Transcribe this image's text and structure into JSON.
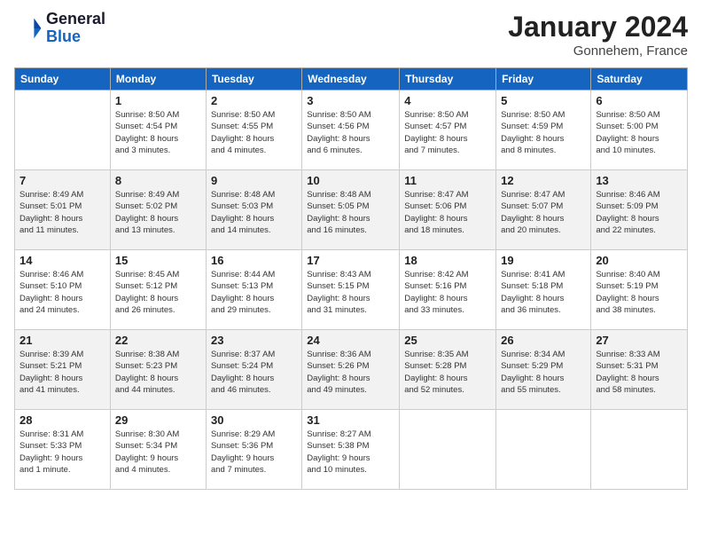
{
  "header": {
    "logo_line1": "General",
    "logo_line2": "Blue",
    "month_title": "January 2024",
    "location": "Gonnehem, France"
  },
  "weekdays": [
    "Sunday",
    "Monday",
    "Tuesday",
    "Wednesday",
    "Thursday",
    "Friday",
    "Saturday"
  ],
  "weeks": [
    [
      {
        "day": "",
        "info": ""
      },
      {
        "day": "1",
        "info": "Sunrise: 8:50 AM\nSunset: 4:54 PM\nDaylight: 8 hours\nand 3 minutes."
      },
      {
        "day": "2",
        "info": "Sunrise: 8:50 AM\nSunset: 4:55 PM\nDaylight: 8 hours\nand 4 minutes."
      },
      {
        "day": "3",
        "info": "Sunrise: 8:50 AM\nSunset: 4:56 PM\nDaylight: 8 hours\nand 6 minutes."
      },
      {
        "day": "4",
        "info": "Sunrise: 8:50 AM\nSunset: 4:57 PM\nDaylight: 8 hours\nand 7 minutes."
      },
      {
        "day": "5",
        "info": "Sunrise: 8:50 AM\nSunset: 4:59 PM\nDaylight: 8 hours\nand 8 minutes."
      },
      {
        "day": "6",
        "info": "Sunrise: 8:50 AM\nSunset: 5:00 PM\nDaylight: 8 hours\nand 10 minutes."
      }
    ],
    [
      {
        "day": "7",
        "info": "Sunrise: 8:49 AM\nSunset: 5:01 PM\nDaylight: 8 hours\nand 11 minutes."
      },
      {
        "day": "8",
        "info": "Sunrise: 8:49 AM\nSunset: 5:02 PM\nDaylight: 8 hours\nand 13 minutes."
      },
      {
        "day": "9",
        "info": "Sunrise: 8:48 AM\nSunset: 5:03 PM\nDaylight: 8 hours\nand 14 minutes."
      },
      {
        "day": "10",
        "info": "Sunrise: 8:48 AM\nSunset: 5:05 PM\nDaylight: 8 hours\nand 16 minutes."
      },
      {
        "day": "11",
        "info": "Sunrise: 8:47 AM\nSunset: 5:06 PM\nDaylight: 8 hours\nand 18 minutes."
      },
      {
        "day": "12",
        "info": "Sunrise: 8:47 AM\nSunset: 5:07 PM\nDaylight: 8 hours\nand 20 minutes."
      },
      {
        "day": "13",
        "info": "Sunrise: 8:46 AM\nSunset: 5:09 PM\nDaylight: 8 hours\nand 22 minutes."
      }
    ],
    [
      {
        "day": "14",
        "info": "Sunrise: 8:46 AM\nSunset: 5:10 PM\nDaylight: 8 hours\nand 24 minutes."
      },
      {
        "day": "15",
        "info": "Sunrise: 8:45 AM\nSunset: 5:12 PM\nDaylight: 8 hours\nand 26 minutes."
      },
      {
        "day": "16",
        "info": "Sunrise: 8:44 AM\nSunset: 5:13 PM\nDaylight: 8 hours\nand 29 minutes."
      },
      {
        "day": "17",
        "info": "Sunrise: 8:43 AM\nSunset: 5:15 PM\nDaylight: 8 hours\nand 31 minutes."
      },
      {
        "day": "18",
        "info": "Sunrise: 8:42 AM\nSunset: 5:16 PM\nDaylight: 8 hours\nand 33 minutes."
      },
      {
        "day": "19",
        "info": "Sunrise: 8:41 AM\nSunset: 5:18 PM\nDaylight: 8 hours\nand 36 minutes."
      },
      {
        "day": "20",
        "info": "Sunrise: 8:40 AM\nSunset: 5:19 PM\nDaylight: 8 hours\nand 38 minutes."
      }
    ],
    [
      {
        "day": "21",
        "info": "Sunrise: 8:39 AM\nSunset: 5:21 PM\nDaylight: 8 hours\nand 41 minutes."
      },
      {
        "day": "22",
        "info": "Sunrise: 8:38 AM\nSunset: 5:23 PM\nDaylight: 8 hours\nand 44 minutes."
      },
      {
        "day": "23",
        "info": "Sunrise: 8:37 AM\nSunset: 5:24 PM\nDaylight: 8 hours\nand 46 minutes."
      },
      {
        "day": "24",
        "info": "Sunrise: 8:36 AM\nSunset: 5:26 PM\nDaylight: 8 hours\nand 49 minutes."
      },
      {
        "day": "25",
        "info": "Sunrise: 8:35 AM\nSunset: 5:28 PM\nDaylight: 8 hours\nand 52 minutes."
      },
      {
        "day": "26",
        "info": "Sunrise: 8:34 AM\nSunset: 5:29 PM\nDaylight: 8 hours\nand 55 minutes."
      },
      {
        "day": "27",
        "info": "Sunrise: 8:33 AM\nSunset: 5:31 PM\nDaylight: 8 hours\nand 58 minutes."
      }
    ],
    [
      {
        "day": "28",
        "info": "Sunrise: 8:31 AM\nSunset: 5:33 PM\nDaylight: 9 hours\nand 1 minute."
      },
      {
        "day": "29",
        "info": "Sunrise: 8:30 AM\nSunset: 5:34 PM\nDaylight: 9 hours\nand 4 minutes."
      },
      {
        "day": "30",
        "info": "Sunrise: 8:29 AM\nSunset: 5:36 PM\nDaylight: 9 hours\nand 7 minutes."
      },
      {
        "day": "31",
        "info": "Sunrise: 8:27 AM\nSunset: 5:38 PM\nDaylight: 9 hours\nand 10 minutes."
      },
      {
        "day": "",
        "info": ""
      },
      {
        "day": "",
        "info": ""
      },
      {
        "day": "",
        "info": ""
      }
    ]
  ]
}
